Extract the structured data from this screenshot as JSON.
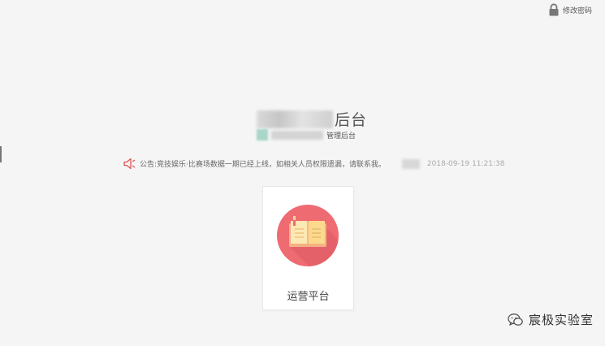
{
  "header": {
    "change_password_label": "修改密码",
    "lock_icon": "lock-icon"
  },
  "brand": {
    "title_visible_tail": "后台",
    "subtitle_visible_tail": "管理后台"
  },
  "notice": {
    "icon": "speaker-icon",
    "text": "公告:竞技娱乐·比赛场数据一期已经上线，如相关人员权限遗漏，请联系我。",
    "timestamp": "2018-09-19 11:21:38"
  },
  "platforms": [
    {
      "icon": "book-icon",
      "label": "运营平台",
      "accent_color": "#ef6b72"
    }
  ],
  "watermark": {
    "icon": "wechat-icon",
    "text": "宸极实验室"
  }
}
